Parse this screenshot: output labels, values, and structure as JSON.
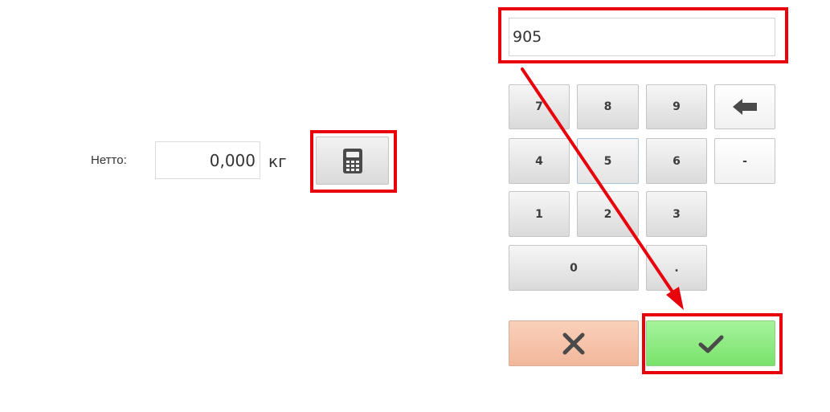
{
  "weight": {
    "label": "Нетто:",
    "value": "0,000",
    "unit": "кг"
  },
  "calculator_button": {
    "icon": "calculator-icon"
  },
  "keypad": {
    "display_value": "905",
    "keys": {
      "k7": "7",
      "k8": "8",
      "k9": "9",
      "k4": "4",
      "k5": "5",
      "k6": "6",
      "k1": "1",
      "k2": "2",
      "k3": "3",
      "k0": "0",
      "decimal": ".",
      "minus": "-"
    },
    "backspace_icon": "backspace-arrow-icon",
    "cancel_icon": "close-icon",
    "confirm_icon": "checkmark-icon"
  },
  "colors": {
    "highlight": "#e8000b",
    "cancel_button": "#f4bca0",
    "confirm_button": "#86e878",
    "icon": "#4a4a4a"
  }
}
